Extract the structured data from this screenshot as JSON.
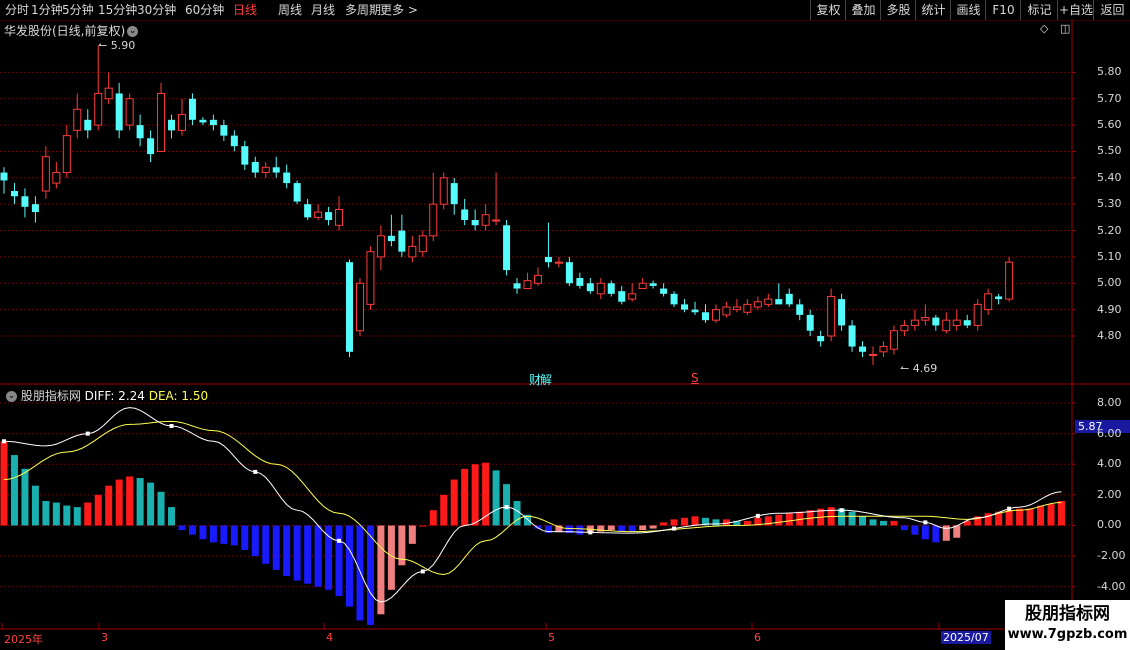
{
  "toolbar": {
    "periods": [
      "分时",
      "1分钟",
      "5分钟",
      "15分钟",
      "30分钟",
      "60分钟",
      "日线",
      "周线",
      "月线",
      "多周期",
      "更多 >"
    ],
    "active_period": "日线",
    "right_buttons": [
      "复权",
      "叠加",
      "多股",
      "统计",
      "画线",
      "F10",
      "标记",
      "+自选",
      "返回"
    ]
  },
  "stock": {
    "title": "华发股份(日线,前复权)",
    "high_label": "5.90",
    "low_label": "4.69",
    "event_labels": [
      "财",
      "解",
      "S"
    ],
    "current_price_badge": "5.87"
  },
  "price_axis": [
    "5.80",
    "5.70",
    "5.60",
    "5.50",
    "5.40",
    "5.30",
    "5.20",
    "5.10",
    "5.00",
    "4.90",
    "4.80"
  ],
  "indicator": {
    "name": "股朋指标网",
    "diff_label": "DIFF: 2.24",
    "dea_label": "DEA: 1.50",
    "axis": [
      "8.00",
      "6.00",
      "4.00",
      "2.00",
      "0.00",
      "-2.00",
      "-4.00"
    ]
  },
  "date_axis": [
    "2025年",
    "3",
    "4",
    "5",
    "6",
    "2025/07"
  ],
  "watermark": {
    "title": "股朋指标网",
    "url": "www.7gpzb.com"
  },
  "colors": {
    "up": "#ff3b3b",
    "down": "#54fcfc",
    "pos_strong": "#ff1a1a",
    "pos_weak": "#1ab0b0",
    "neg_strong": "#1a1aff",
    "neg_weak": "#f08080",
    "diff": "#ffffff",
    "dea": "#ffff50",
    "grid": "#8a0000",
    "ma": "#ffffff"
  },
  "candles": [
    [
      5.42,
      5.39,
      5.44,
      5.34
    ],
    [
      5.35,
      5.33,
      5.38,
      5.3
    ],
    [
      5.33,
      5.29,
      5.36,
      5.25
    ],
    [
      5.3,
      5.27,
      5.33,
      5.23
    ],
    [
      5.35,
      5.48,
      5.52,
      5.32
    ],
    [
      5.38,
      5.42,
      5.46,
      5.36
    ],
    [
      5.42,
      5.56,
      5.6,
      5.4
    ],
    [
      5.58,
      5.66,
      5.72,
      5.55
    ],
    [
      5.62,
      5.58,
      5.66,
      5.55
    ],
    [
      5.6,
      5.72,
      5.9,
      5.58
    ],
    [
      5.7,
      5.74,
      5.8,
      5.68
    ],
    [
      5.72,
      5.58,
      5.76,
      5.55
    ],
    [
      5.6,
      5.7,
      5.72,
      5.58
    ],
    [
      5.6,
      5.55,
      5.64,
      5.52
    ],
    [
      5.55,
      5.49,
      5.58,
      5.46
    ],
    [
      5.5,
      5.72,
      5.76,
      5.5
    ],
    [
      5.62,
      5.58,
      5.64,
      5.55
    ],
    [
      5.58,
      5.64,
      5.7,
      5.56
    ],
    [
      5.7,
      5.62,
      5.72,
      5.6
    ],
    [
      5.62,
      5.61,
      5.63,
      5.6
    ],
    [
      5.62,
      5.6,
      5.64,
      5.58
    ],
    [
      5.6,
      5.56,
      5.62,
      5.54
    ],
    [
      5.56,
      5.52,
      5.58,
      5.5
    ],
    [
      5.52,
      5.45,
      5.54,
      5.43
    ],
    [
      5.46,
      5.42,
      5.48,
      5.4
    ],
    [
      5.42,
      5.44,
      5.46,
      5.4
    ],
    [
      5.44,
      5.42,
      5.48,
      5.4
    ],
    [
      5.42,
      5.38,
      5.45,
      5.36
    ],
    [
      5.38,
      5.31,
      5.39,
      5.3
    ],
    [
      5.3,
      5.25,
      5.32,
      5.24
    ],
    [
      5.25,
      5.27,
      5.3,
      5.24
    ],
    [
      5.27,
      5.24,
      5.29,
      5.22
    ],
    [
      5.22,
      5.28,
      5.33,
      5.2
    ],
    [
      5.08,
      4.74,
      5.09,
      4.72
    ],
    [
      4.82,
      5.0,
      5.02,
      4.8
    ],
    [
      4.92,
      5.12,
      5.14,
      4.9
    ],
    [
      5.1,
      5.18,
      5.22,
      5.05
    ],
    [
      5.18,
      5.16,
      5.26,
      5.14
    ],
    [
      5.2,
      5.12,
      5.26,
      5.1
    ],
    [
      5.1,
      5.14,
      5.18,
      5.08
    ],
    [
      5.12,
      5.18,
      5.2,
      5.1
    ],
    [
      5.18,
      5.3,
      5.42,
      5.16
    ],
    [
      5.3,
      5.4,
      5.42,
      5.28
    ],
    [
      5.38,
      5.3,
      5.4,
      5.26
    ],
    [
      5.28,
      5.24,
      5.32,
      5.22
    ],
    [
      5.24,
      5.22,
      5.28,
      5.2
    ],
    [
      5.22,
      5.26,
      5.3,
      5.2
    ],
    [
      5.24,
      5.24,
      5.42,
      5.22
    ],
    [
      5.22,
      5.05,
      5.24,
      5.03
    ],
    [
      5.0,
      4.98,
      5.02,
      4.96
    ],
    [
      4.98,
      5.01,
      5.04,
      4.98
    ],
    [
      5.0,
      5.03,
      5.06,
      4.99
    ],
    [
      5.1,
      5.08,
      5.23,
      5.06
    ],
    [
      5.08,
      5.08,
      5.1,
      5.06
    ],
    [
      5.08,
      5.0,
      5.1,
      4.99
    ],
    [
      5.02,
      4.99,
      5.04,
      4.98
    ],
    [
      5.0,
      4.97,
      5.02,
      4.96
    ],
    [
      4.96,
      5.0,
      5.02,
      4.94
    ],
    [
      5.0,
      4.96,
      5.01,
      4.95
    ],
    [
      4.97,
      4.93,
      4.99,
      4.92
    ],
    [
      4.94,
      4.96,
      5.0,
      4.93
    ],
    [
      4.98,
      5.0,
      5.02,
      4.98
    ],
    [
      5.0,
      4.99,
      5.01,
      4.98
    ],
    [
      4.98,
      4.96,
      5.0,
      4.95
    ],
    [
      4.96,
      4.92,
      4.97,
      4.91
    ],
    [
      4.92,
      4.9,
      4.94,
      4.89
    ],
    [
      4.9,
      4.89,
      4.93,
      4.88
    ],
    [
      4.89,
      4.86,
      4.92,
      4.85
    ],
    [
      4.86,
      4.9,
      4.92,
      4.85
    ],
    [
      4.88,
      4.91,
      4.93,
      4.87
    ],
    [
      4.9,
      4.91,
      4.94,
      4.89
    ],
    [
      4.89,
      4.92,
      4.94,
      4.88
    ],
    [
      4.91,
      4.93,
      4.95,
      4.9
    ],
    [
      4.92,
      4.94,
      4.96,
      4.91
    ],
    [
      4.94,
      4.92,
      5.0,
      4.92
    ],
    [
      4.96,
      4.92,
      4.98,
      4.91
    ],
    [
      4.92,
      4.88,
      4.94,
      4.86
    ],
    [
      4.88,
      4.82,
      4.9,
      4.8
    ],
    [
      4.8,
      4.78,
      4.82,
      4.76
    ],
    [
      4.8,
      4.95,
      4.98,
      4.78
    ],
    [
      4.94,
      4.84,
      4.96,
      4.82
    ],
    [
      4.84,
      4.76,
      4.86,
      4.74
    ],
    [
      4.76,
      4.74,
      4.78,
      4.72
    ],
    [
      4.73,
      4.73,
      4.76,
      4.69
    ],
    [
      4.74,
      4.76,
      4.78,
      4.72
    ],
    [
      4.75,
      4.82,
      4.84,
      4.73
    ],
    [
      4.82,
      4.84,
      4.86,
      4.8
    ],
    [
      4.84,
      4.86,
      4.9,
      4.82
    ],
    [
      4.86,
      4.87,
      4.92,
      4.84
    ],
    [
      4.87,
      4.84,
      4.88,
      4.82
    ],
    [
      4.82,
      4.86,
      4.89,
      4.81
    ],
    [
      4.84,
      4.86,
      4.9,
      4.82
    ],
    [
      4.86,
      4.84,
      4.88,
      4.83
    ],
    [
      4.84,
      4.92,
      4.94,
      4.82
    ],
    [
      4.9,
      4.96,
      4.98,
      4.88
    ],
    [
      4.95,
      4.94,
      4.96,
      4.92
    ],
    [
      4.94,
      5.08,
      5.1,
      4.93
    ]
  ],
  "macd_hist": [
    5.5,
    4.6,
    3.7,
    2.6,
    1.6,
    1.5,
    1.3,
    1.2,
    1.5,
    2.0,
    2.6,
    3.0,
    3.2,
    3.1,
    2.8,
    2.2,
    1.2,
    -0.3,
    -0.6,
    -0.9,
    -1.1,
    -1.2,
    -1.3,
    -1.6,
    -2.0,
    -2.5,
    -2.9,
    -3.3,
    -3.6,
    -3.8,
    -4.0,
    -4.2,
    -4.6,
    -5.3,
    -6.2,
    -6.5,
    -5.8,
    -4.2,
    -2.6,
    -1.2,
    0,
    1.0,
    2.0,
    3.0,
    3.7,
    4.0,
    4.1,
    3.6,
    2.7,
    1.6,
    0.7,
    -0.2,
    -0.5,
    -0.4,
    -0.5,
    -0.6,
    -0.5,
    -0.4,
    -0.3,
    -0.4,
    -0.4,
    -0.3,
    -0.2,
    0.2,
    0.4,
    0.5,
    0.6,
    0.5,
    0.4,
    0.4,
    0.3,
    0.3,
    0.5,
    0.6,
    0.7,
    0.8,
    0.9,
    1.0,
    1.1,
    1.2,
    1.1,
    0.9,
    0.6,
    0.4,
    0.3,
    0.3,
    -0.3,
    -0.6,
    -0.9,
    -1.1,
    -1.0,
    -0.8,
    0.3,
    0.6,
    0.8,
    0.9,
    1.0,
    1.1,
    1.1,
    1.3,
    1.4,
    1.6
  ],
  "ma_anchors": [
    [
      0,
      5.48
    ],
    [
      5,
      5.46
    ],
    [
      10,
      5.62
    ],
    [
      17,
      5.64
    ],
    [
      25,
      5.5
    ],
    [
      32,
      5.3
    ],
    [
      36,
      5.1
    ],
    [
      42,
      5.18
    ],
    [
      47,
      5.22
    ],
    [
      52,
      5.1
    ],
    [
      58,
      5.0
    ],
    [
      66,
      4.95
    ],
    [
      75,
      4.92
    ],
    [
      82,
      4.85
    ],
    [
      89,
      4.8
    ],
    [
      97,
      4.93
    ]
  ],
  "diff_anchors": [
    [
      0,
      5.5
    ],
    [
      4,
      5.2
    ],
    [
      8,
      6.0
    ],
    [
      12,
      7.7
    ],
    [
      16,
      6.5
    ],
    [
      20,
      5.5
    ],
    [
      24,
      3.5
    ],
    [
      28,
      1.0
    ],
    [
      32,
      -1.0
    ],
    [
      36,
      -5.0
    ],
    [
      40,
      -3.0
    ],
    [
      44,
      0.0
    ],
    [
      48,
      1.2
    ],
    [
      52,
      -0.4
    ],
    [
      60,
      -0.5
    ],
    [
      68,
      0.1
    ],
    [
      74,
      0.8
    ],
    [
      80,
      1.0
    ],
    [
      86,
      0.5
    ],
    [
      88,
      0.2
    ],
    [
      90,
      -0.2
    ],
    [
      93,
      0.5
    ],
    [
      97,
      1.2
    ],
    [
      101,
      2.2
    ]
  ],
  "dea_anchors": [
    [
      0,
      3.0
    ],
    [
      6,
      4.8
    ],
    [
      12,
      6.6
    ],
    [
      16,
      6.8
    ],
    [
      20,
      6.2
    ],
    [
      26,
      4.0
    ],
    [
      32,
      0.8
    ],
    [
      38,
      -2.2
    ],
    [
      42,
      -3.2
    ],
    [
      46,
      -1.0
    ],
    [
      50,
      0.6
    ],
    [
      54,
      -0.2
    ],
    [
      60,
      -0.4
    ],
    [
      70,
      0.0
    ],
    [
      80,
      0.6
    ],
    [
      88,
      0.6
    ],
    [
      92,
      0.4
    ],
    [
      97,
      1.0
    ],
    [
      101,
      1.5
    ]
  ]
}
